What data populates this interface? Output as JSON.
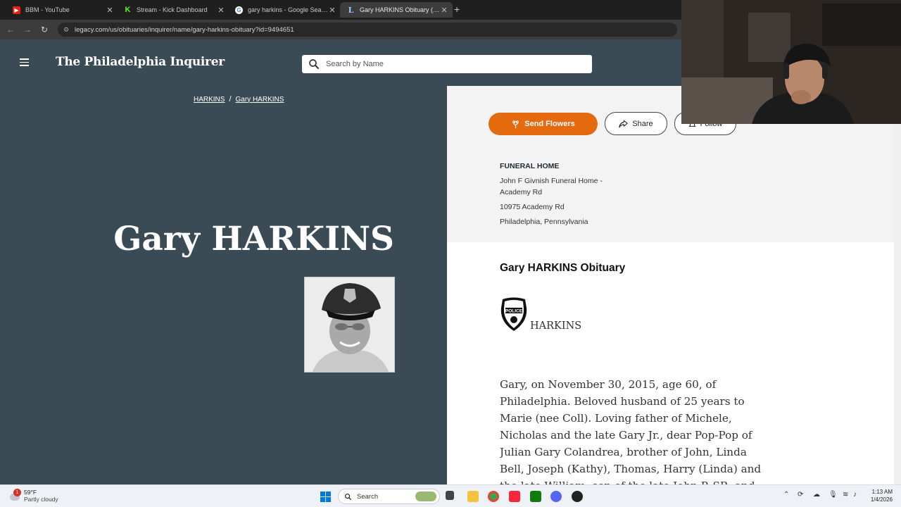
{
  "browser": {
    "tabs": [
      {
        "title": "BBM - YouTube",
        "icon": "youtube-icon",
        "active": false
      },
      {
        "title": "Stream - Kick Dashboard",
        "icon": "kick-icon",
        "active": false
      },
      {
        "title": "gary harkins - Google Search",
        "icon": "google-icon",
        "active": false
      },
      {
        "title": "Gary HARKINS Obituary (2015)",
        "icon": "legacy-icon",
        "active": true
      }
    ],
    "url": "legacy.com/us/obituaries/inquirer/name/gary-harkins-obituary?id=9494651"
  },
  "header": {
    "logo": "The Philadelphia Inquirer",
    "search_placeholder": "Search by Name"
  },
  "breadcrumb": [
    "HARKINS",
    "Gary HARKINS"
  ],
  "hero": {
    "name": "Gary HARKINS"
  },
  "actions": {
    "send_flowers": "Send Flowers",
    "share": "Share",
    "follow": "Follow"
  },
  "funeral_home": {
    "label": "FUNERAL HOME",
    "name": "John F Givnish Funeral Home - Academy Rd",
    "address": "10975 Academy Rd",
    "city": "Philadelphia, Pennsylvania"
  },
  "obituary": {
    "title": "Gary HARKINS Obituary",
    "badge_text": "POLICE",
    "surname": "HARKINS",
    "text": "Gary, on November 30, 2015, age 60, of Philadelphia. Beloved husband of 25 years to Marie (nee Coll). Loving father of Michele, Nicholas and the late Gary Jr., dear Pop-Pop of Julian Gary Colandrea, brother of John, Linda Bell, Joseph (Kathy), Thomas, Harry (Linda) and the late William, son of the late John P. SR. and Althea"
  },
  "taskbar": {
    "weather_temp": "59°F",
    "weather_cond": "Partly cloudy",
    "weather_alert": "1",
    "search": "Search",
    "time": "1:13 AM",
    "date": "1/4/2026"
  },
  "colors": {
    "header_bg": "#3b4b55",
    "accent_orange": "#e5690f"
  }
}
